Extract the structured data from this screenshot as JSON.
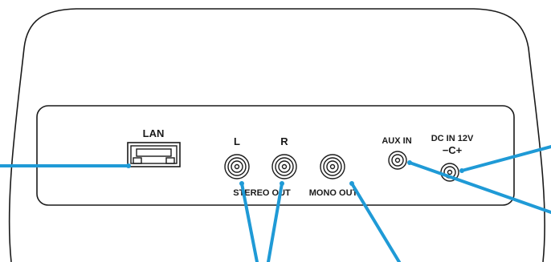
{
  "labels": {
    "lan": "LAN",
    "left": "L",
    "right": "R",
    "stereo_out": "STEREO OUT",
    "mono_out": "MONO OUT",
    "aux_in": "AUX IN",
    "dc_in": "DC IN 12V",
    "dc_polarity": "−C+"
  },
  "colors": {
    "callout": "#1f9ad6",
    "outline": "#1a1a1a",
    "background": "#ffffff"
  }
}
